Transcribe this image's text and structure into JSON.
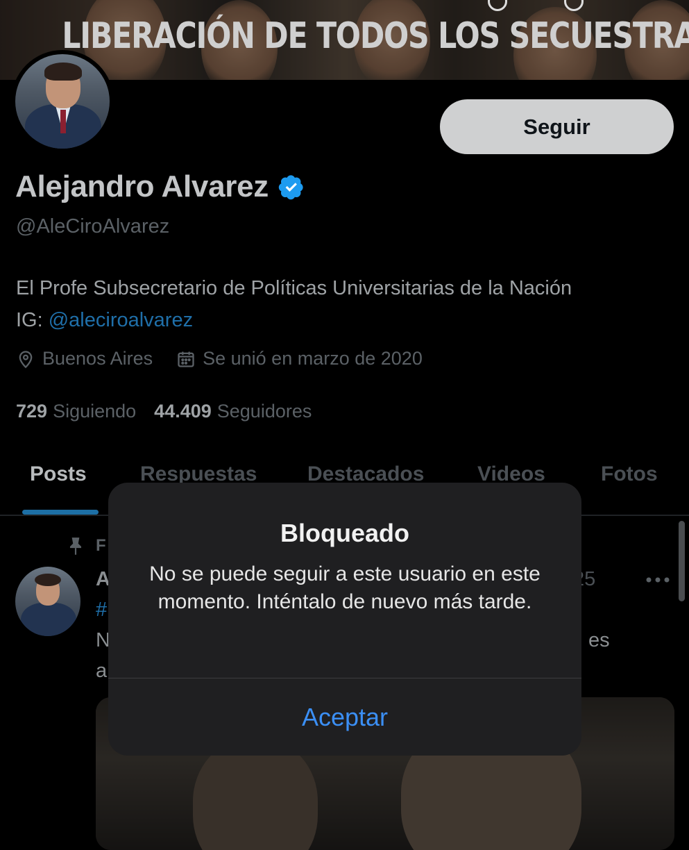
{
  "banner": {
    "text": "LIBERACIÓN DE TODOS LOS SECUESTRADOS"
  },
  "profile": {
    "follow_label": "Seguir",
    "name": "Alejandro Alvarez",
    "handle": "@AleCiroAlvarez",
    "bio_line1": "El Profe Subsecretario de Políticas Universitarias de la Nación",
    "bio_prefix": "IG: ",
    "bio_link": "@aleciroalvarez",
    "location": "Buenos Aires",
    "joined": "Se unió en marzo de 2020",
    "following_count": "729",
    "following_label": "Siguiendo",
    "followers_count": "44.409",
    "followers_label": "Seguidores"
  },
  "tabs": [
    {
      "label": "Posts"
    },
    {
      "label": "Respuestas"
    },
    {
      "label": "Destacados"
    },
    {
      "label": "Videos"
    },
    {
      "label": "Fotos"
    }
  ],
  "post": {
    "pinned_fragment": "F",
    "name_fragment": "A",
    "time_fragment": "25",
    "hashtag_fragment": "#",
    "text_fragment_left": "N",
    "text_fragment_right": "es",
    "text_fragment_line4": "a"
  },
  "alert": {
    "title": "Bloqueado",
    "message": "No se puede seguir a este usuario en este momento. Inténtalo de nuevo más tarde.",
    "button": "Aceptar"
  },
  "colors": {
    "accent_link": "#1f6fa9",
    "ios_button_blue": "#3b8ff5",
    "verified_blue": "#1d9bf0"
  }
}
